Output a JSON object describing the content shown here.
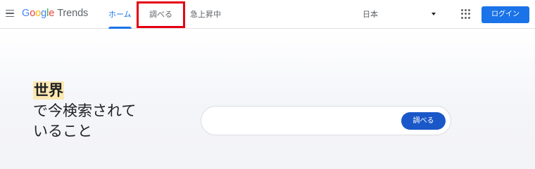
{
  "header": {
    "logo": {
      "letters": [
        "G",
        "o",
        "o",
        "g",
        "l",
        "e"
      ],
      "letter_colors": [
        "#4285f4",
        "#ea4335",
        "#fbbc05",
        "#4285f4",
        "#34a853",
        "#ea4335"
      ],
      "product": "Trends"
    },
    "nav": {
      "home": "ホーム",
      "explore": "調べる",
      "trending": "急上昇中",
      "active_tab": "home"
    },
    "region": {
      "value": "日本"
    },
    "login_label": "ログイン"
  },
  "hero": {
    "highlight": "世界",
    "line2": "で今検索されて",
    "line3": "いること"
  },
  "search": {
    "placeholder": "",
    "button_label": "調べる"
  },
  "colors": {
    "accent": "#1a73e8",
    "annotation_box": "#e60012",
    "highlight": "#fce8b2"
  }
}
